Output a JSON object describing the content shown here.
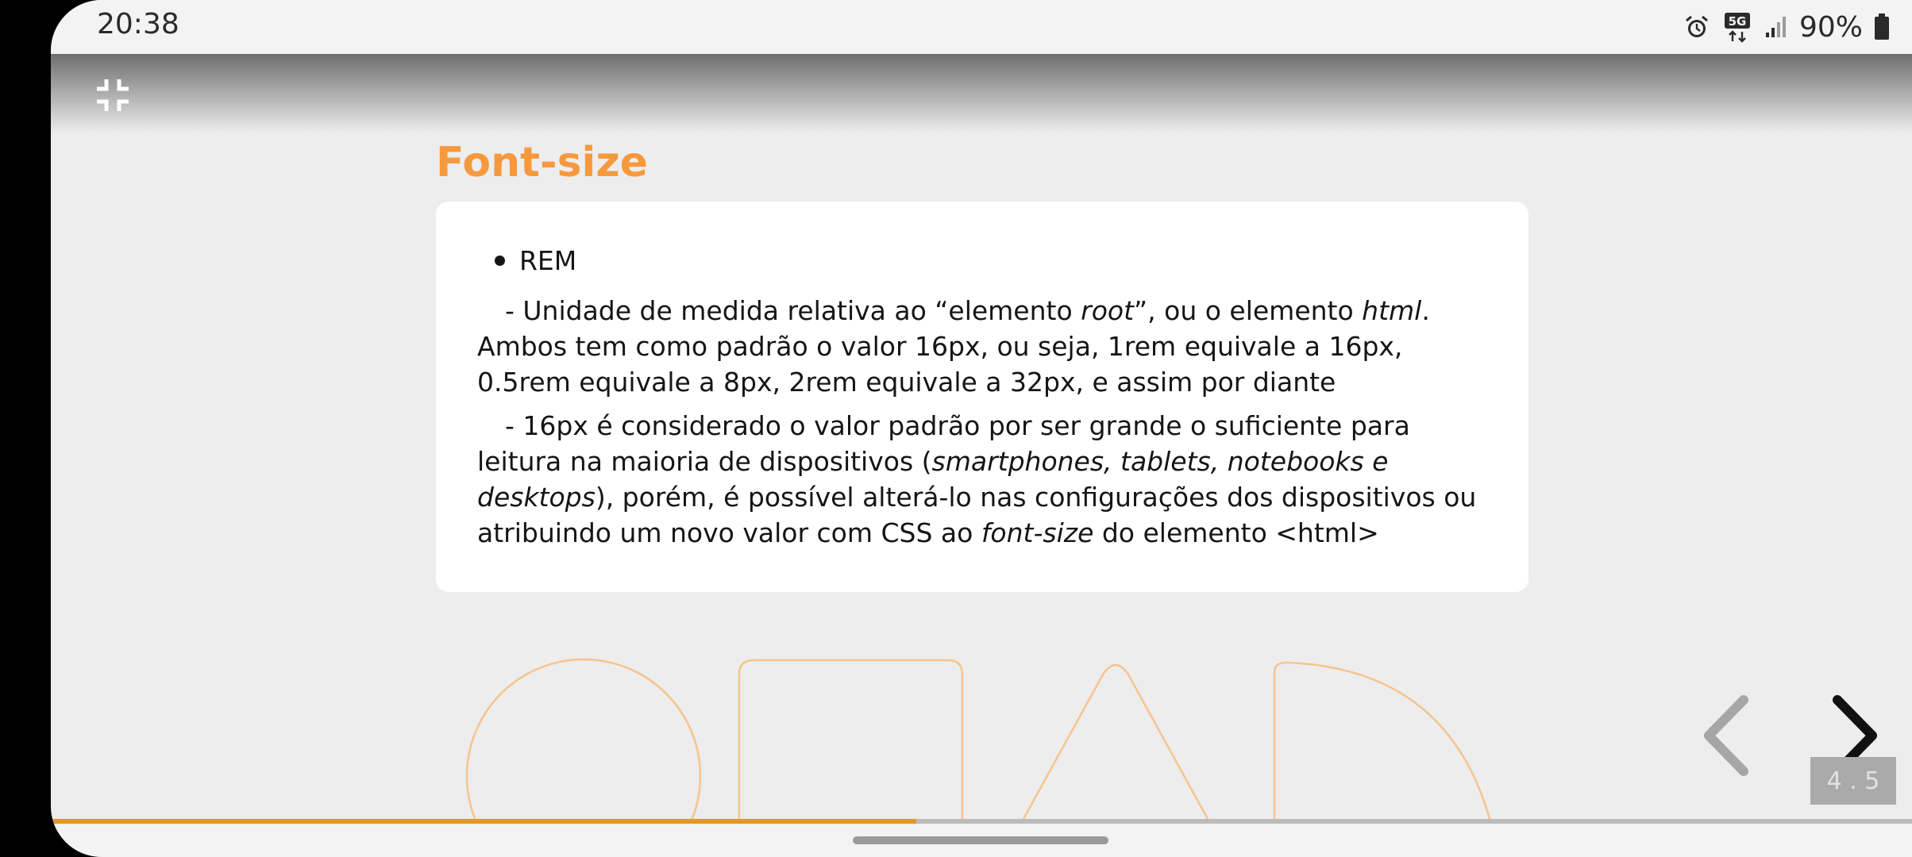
{
  "status_bar": {
    "time": "20:38",
    "network": "5G",
    "battery": "90%",
    "icons": [
      "alarm-icon",
      "5g-data-icon",
      "signal-icon",
      "battery-icon"
    ]
  },
  "toolbar": {
    "exit_fullscreen_icon": "exit-fullscreen-icon"
  },
  "slide": {
    "title": "Font-size",
    "bullet": "REM",
    "p1": {
      "a": "- Unidade de medida relativa ao “elemento ",
      "b": "root",
      "c": "”, ou o elemento ",
      "d": "html",
      "e": ". Ambos tem como padrão o valor 16px, ou seja, 1rem equivale a 16px, 0.5rem equivale a 8px, 2rem equivale a 32px, e assim por diante"
    },
    "p2": {
      "a": "- 16px é considerado o valor padrão por ser grande o suficiente para leitura na maioria de dispositivos (",
      "b": "smartphones, tablets, notebooks e desktops",
      "c": "), porém, é possível alterá-lo nas configurações dos dispositivos ou atribuindo um novo valor com CSS ao ",
      "d": "font-size",
      "e": " do elemento <html>"
    }
  },
  "navigation": {
    "prev_icon": "chevron-left-icon",
    "next_icon": "chevron-right-icon",
    "slide_number": "4 . 5",
    "progress": 0.465
  },
  "colors": {
    "accent": "#f6993d",
    "progress": "#e2962e",
    "background": "#ededed"
  }
}
